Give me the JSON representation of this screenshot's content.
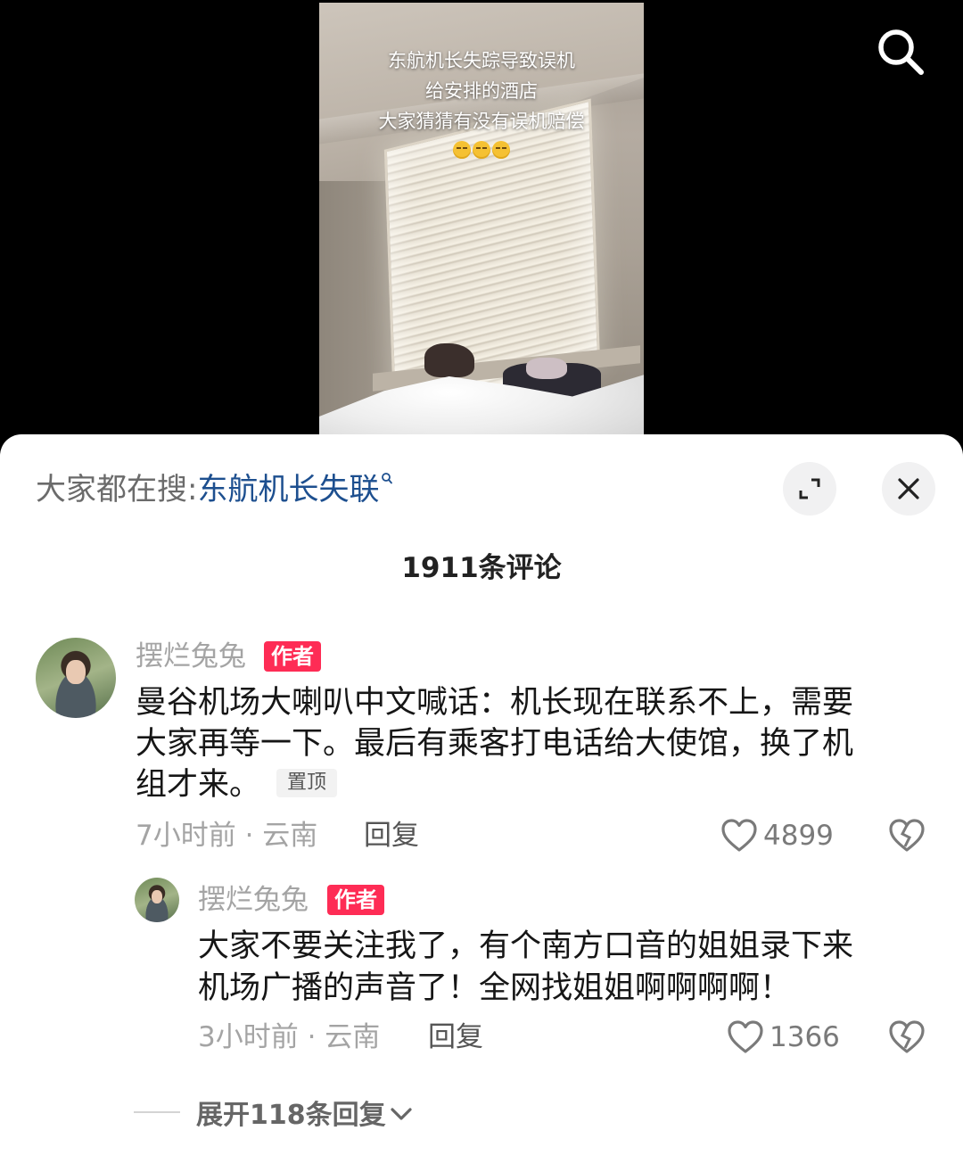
{
  "video": {
    "caption_lines": [
      "东航机长失踪导致误机",
      "给安排的酒店",
      "大家猜猜有没有误机赔偿"
    ],
    "caption_emoji": "😔😔😔"
  },
  "top_bar": {
    "search_icon": "search-icon"
  },
  "sheet": {
    "hot_search": {
      "prefix": "大家都在搜:",
      "keyword": "东航机长失联"
    },
    "expand_icon": "expand-icon",
    "close_icon": "close-icon",
    "comment_count": "1911条评论",
    "comments": [
      {
        "username": "摆烂兔兔",
        "author_tag": "作者",
        "text_lines": [
          "曼谷机场大喇叭中文喊话：机长现在联系不上，需要",
          "大家再等一下。最后有乘客打电话给大使馆，换了机",
          "组才来。"
        ],
        "pin_tag": "置顶",
        "meta": "7小时前 · 云南",
        "reply_label": "回复",
        "likes": "4899"
      }
    ],
    "replies": [
      {
        "username": "摆烂兔兔",
        "author_tag": "作者",
        "text_lines": [
          "大家不要关注我了，有个南方口音的姐姐录下来",
          "机场广播的声音了！全网找姐姐啊啊啊啊！"
        ],
        "meta": "3小时前 · 云南",
        "reply_label": "回复",
        "likes": "1366"
      }
    ],
    "expand_replies_label": "展开118条回复"
  },
  "colors": {
    "author_tag": "#fe2c55",
    "keyword": "#1d4f8f"
  }
}
